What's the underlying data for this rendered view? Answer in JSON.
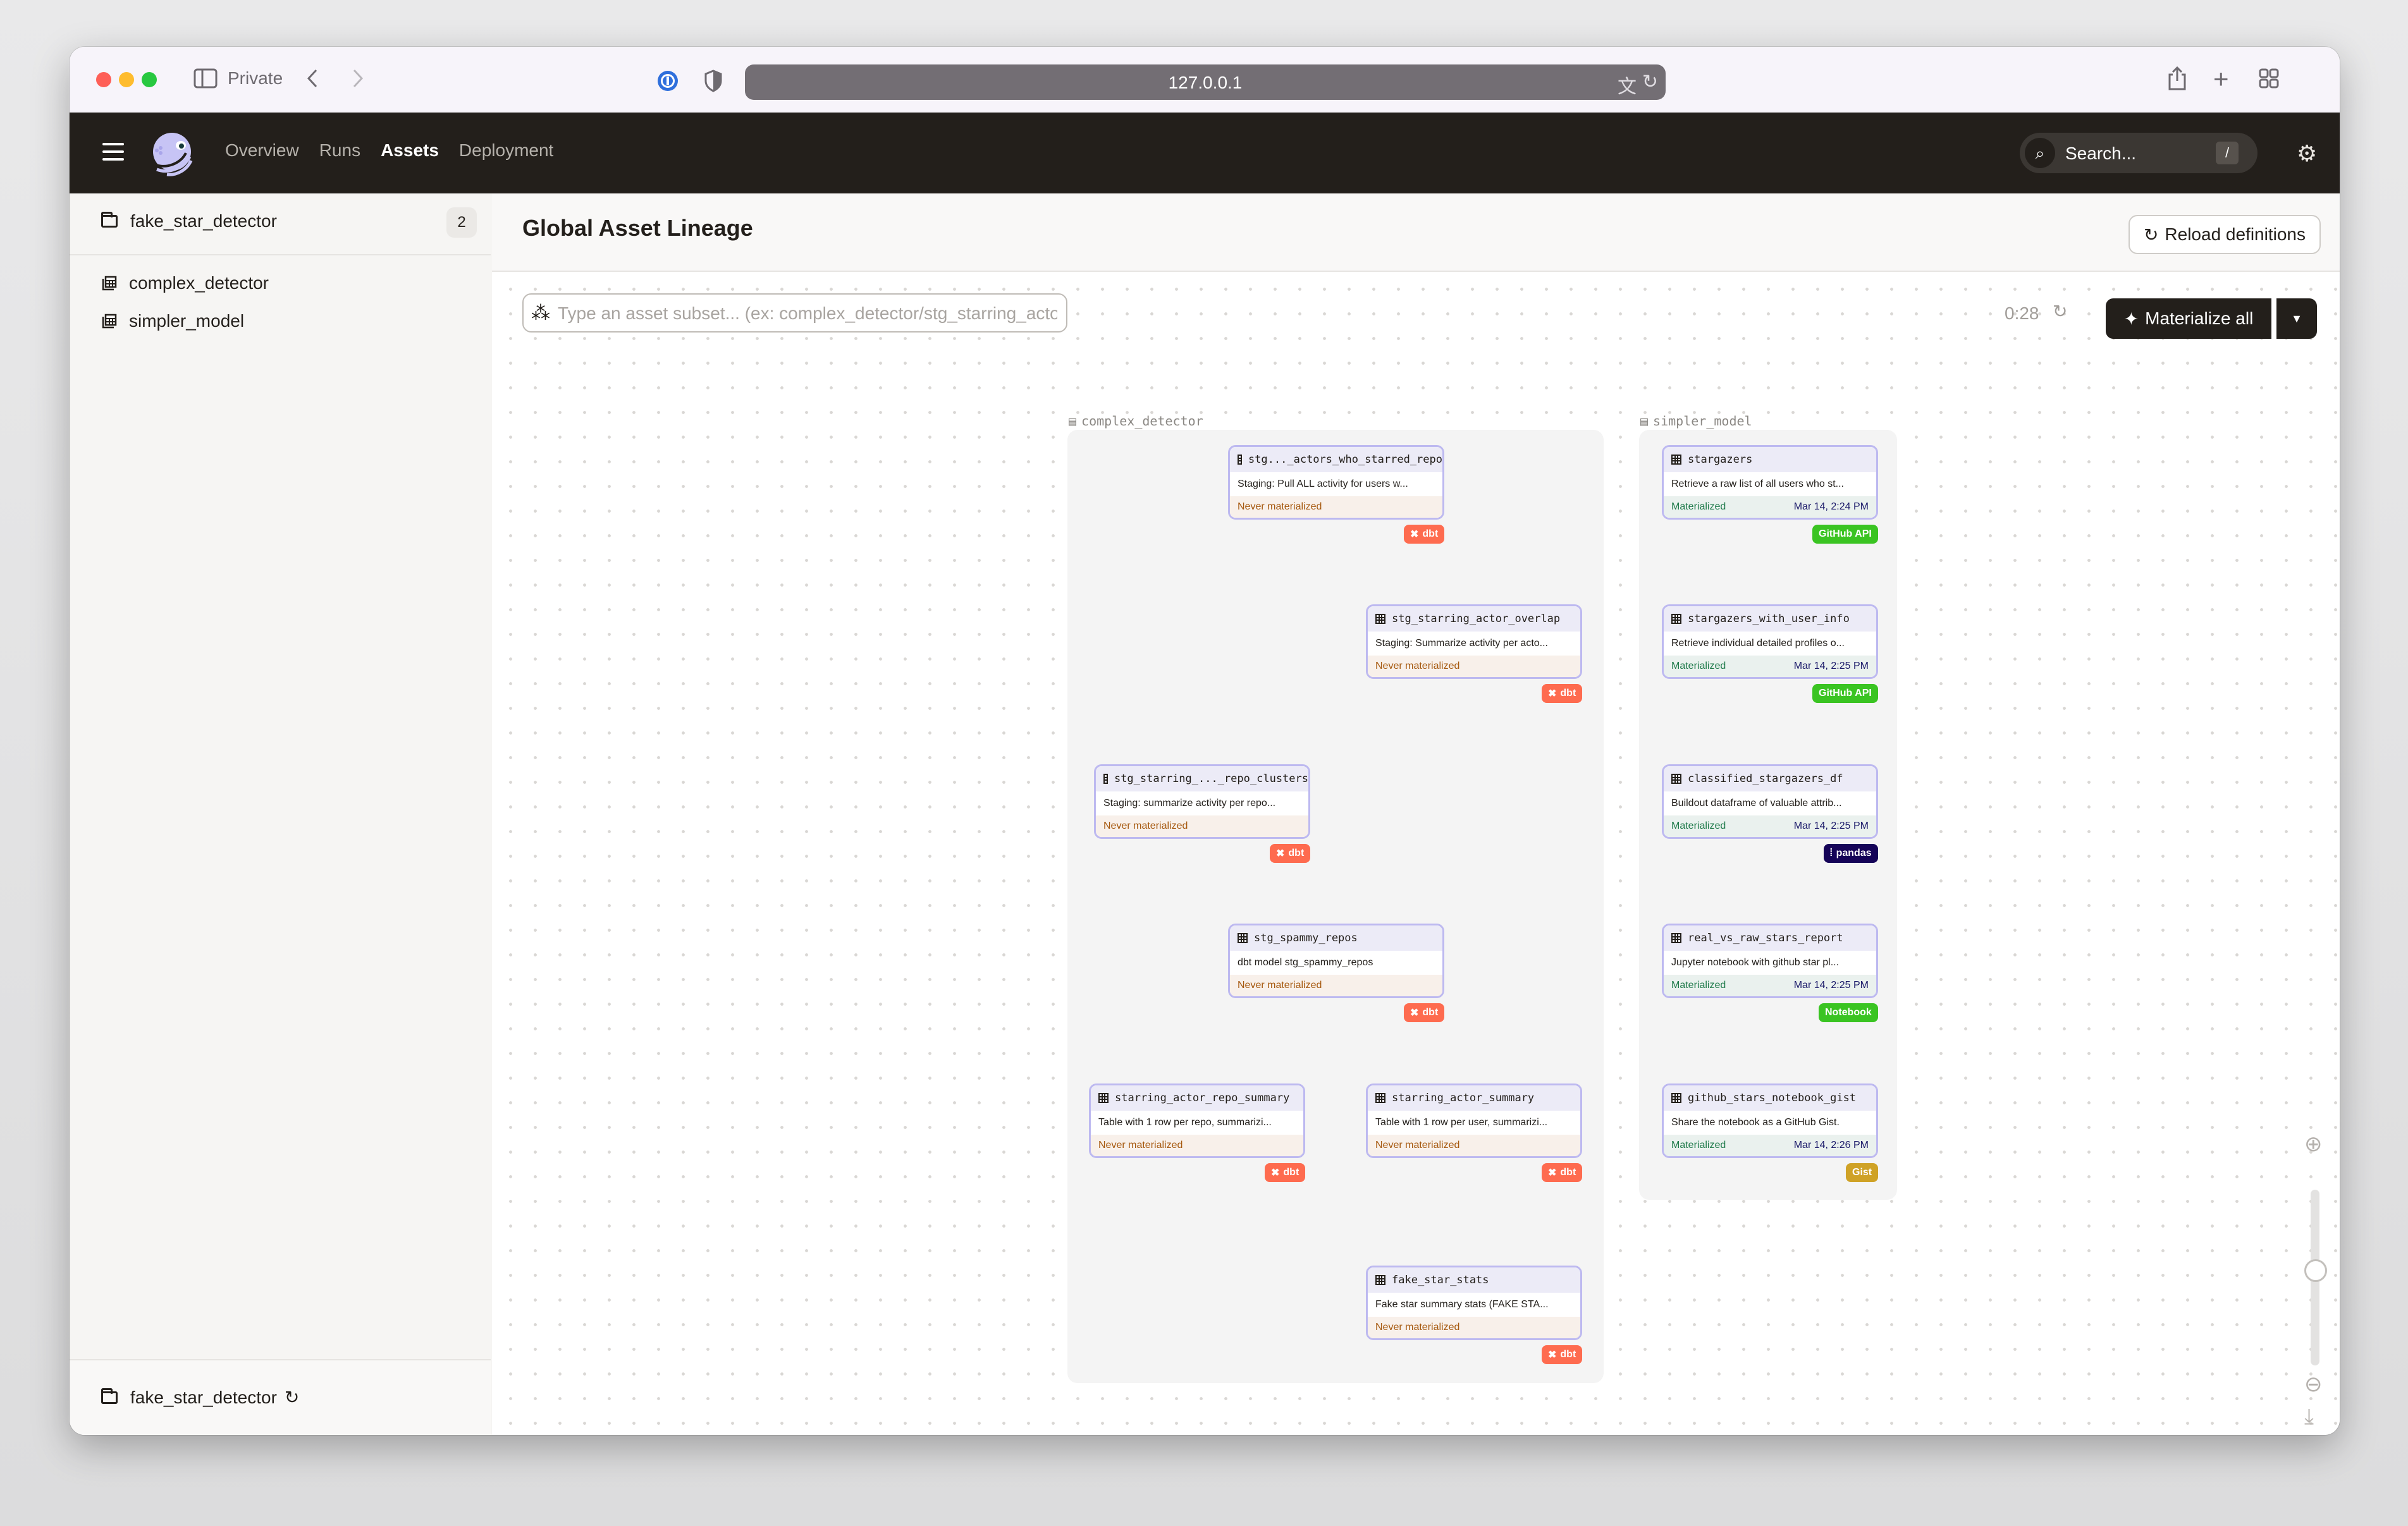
{
  "browser": {
    "mode_label": "Private",
    "url": "127.0.0.1"
  },
  "header": {
    "nav": [
      {
        "label": "Overview",
        "active": false
      },
      {
        "label": "Runs",
        "active": false
      },
      {
        "label": "Assets",
        "active": true
      },
      {
        "label": "Deployment",
        "active": false
      }
    ],
    "search_placeholder": "Search...",
    "search_shortcut": "/"
  },
  "sidebar": {
    "location": {
      "name": "fake_star_detector",
      "count": "2"
    },
    "repositories": [
      {
        "name": "complex_detector"
      },
      {
        "name": "simpler_model"
      }
    ],
    "footer_location": "fake_star_detector"
  },
  "main": {
    "title": "Global Asset Lineage",
    "reload_label": "Reload definitions",
    "subset_placeholder": "Type an asset subset... (ex: complex_detector/stg_starring_actor_overlap)",
    "subset_value": "",
    "refresh_timer": "0:28",
    "materialize_label": "Materialize all"
  },
  "colors": {
    "dbt": "#fe6b4f",
    "github_api": "#3ac422",
    "pandas": "#150458",
    "notebook": "#3ac422",
    "gist": "#cfa226",
    "node_border": "#bdb9f0",
    "never_materialized": "#a6590f",
    "materialized": "#1e7a4a"
  },
  "graph": {
    "groups": [
      {
        "name": "complex_detector"
      },
      {
        "name": "simpler_model"
      }
    ],
    "nodes": [
      {
        "id": "stg_actors",
        "name": "stg..._actors_who_starred_repo",
        "description": "Staging: Pull ALL activity for users w...",
        "status": "Never materialized",
        "timestamp": "",
        "kind": "dbt"
      },
      {
        "id": "stg_overlap",
        "name": "stg_starring_actor_overlap",
        "description": "Staging: Summarize activity per acto...",
        "status": "Never materialized",
        "timestamp": "",
        "kind": "dbt"
      },
      {
        "id": "stg_clusters",
        "name": "stg_starring_..._repo_clusters",
        "description": "Staging: summarize activity per repo...",
        "status": "Never materialized",
        "timestamp": "",
        "kind": "dbt"
      },
      {
        "id": "stg_spammy",
        "name": "stg_spammy_repos",
        "description": "dbt model stg_spammy_repos",
        "status": "Never materialized",
        "timestamp": "",
        "kind": "dbt"
      },
      {
        "id": "repo_summary",
        "name": "starring_actor_repo_summary",
        "description": "Table with 1 row per repo, summarizi...",
        "status": "Never materialized",
        "timestamp": "",
        "kind": "dbt"
      },
      {
        "id": "actor_summary",
        "name": "starring_actor_summary",
        "description": "Table with 1 row per user, summarizi...",
        "status": "Never materialized",
        "timestamp": "",
        "kind": "dbt"
      },
      {
        "id": "fake_stats",
        "name": "fake_star_stats",
        "description": "Fake star summary stats (FAKE STA...",
        "status": "Never materialized",
        "timestamp": "",
        "kind": "dbt"
      },
      {
        "id": "stargazers",
        "name": "stargazers",
        "description": "Retrieve a raw list of all users who st...",
        "status": "Materialized",
        "timestamp": "Mar 14, 2:24 PM",
        "kind": "GitHub API"
      },
      {
        "id": "with_info",
        "name": "stargazers_with_user_info",
        "description": "Retrieve individual detailed profiles o...",
        "status": "Materialized",
        "timestamp": "Mar 14, 2:25 PM",
        "kind": "GitHub API"
      },
      {
        "id": "classified",
        "name": "classified_stargazers_df",
        "description": "Buildout dataframe of valuable attrib...",
        "status": "Materialized",
        "timestamp": "Mar 14, 2:25 PM",
        "kind": "pandas"
      },
      {
        "id": "report",
        "name": "real_vs_raw_stars_report",
        "description": "Jupyter notebook with github star pl...",
        "status": "Materialized",
        "timestamp": "Mar 14, 2:25 PM",
        "kind": "Notebook"
      },
      {
        "id": "gist",
        "name": "github_stars_notebook_gist",
        "description": "Share the notebook as a GitHub Gist.",
        "status": "Materialized",
        "timestamp": "Mar 14, 2:26 PM",
        "kind": "Gist"
      }
    ],
    "edges": [
      [
        "stg_actors",
        "stg_overlap"
      ],
      [
        "stg_actors",
        "stg_clusters"
      ],
      [
        "stg_overlap",
        "stg_clusters"
      ],
      [
        "stg_overlap",
        "actor_summary"
      ],
      [
        "stg_clusters",
        "stg_spammy"
      ],
      [
        "stg_clusters",
        "repo_summary"
      ],
      [
        "stg_spammy",
        "repo_summary"
      ],
      [
        "stg_spammy",
        "actor_summary"
      ],
      [
        "actor_summary",
        "fake_stats"
      ],
      [
        "stargazers",
        "with_info"
      ],
      [
        "with_info",
        "classified"
      ],
      [
        "classified",
        "report"
      ],
      [
        "report",
        "gist"
      ]
    ]
  }
}
